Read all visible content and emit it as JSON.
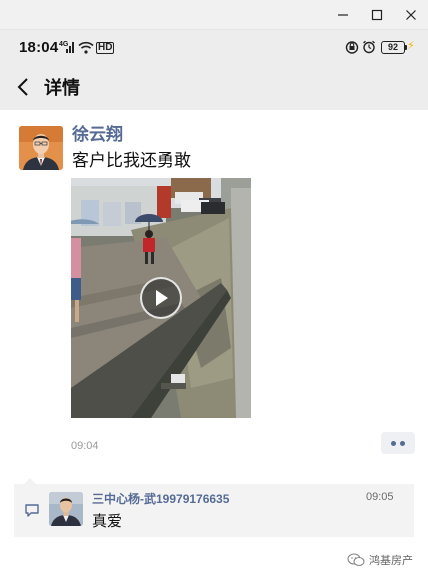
{
  "window": {
    "minimize_icon": "minimize-icon",
    "maximize_icon": "maximize-icon",
    "close_icon": "close-icon"
  },
  "status_bar": {
    "time": "18:04",
    "signal_label": "4G",
    "network_label": "HD",
    "battery": "92",
    "icons": [
      "signal-icon",
      "wifi-icon",
      "nfc-icon",
      "alarm-icon",
      "battery-icon",
      "charging-icon"
    ]
  },
  "nav": {
    "title": "详情",
    "back_icon": "chevron-left-icon"
  },
  "post": {
    "author": "徐云翔",
    "text": "客户比我还勇敢",
    "time": "09:04",
    "video_icon": "play-icon",
    "more_icon": "more-dots-icon"
  },
  "comments": [
    {
      "name": "三中心杨-武19979176635",
      "time": "09:05",
      "text": "真爱"
    }
  ],
  "watermark": {
    "text": "鸿基房产",
    "icon": "wechat-icon"
  },
  "colors": {
    "link_blue": "#566b94",
    "header_bg": "#ededed",
    "comment_bg": "#f3f3f3"
  }
}
